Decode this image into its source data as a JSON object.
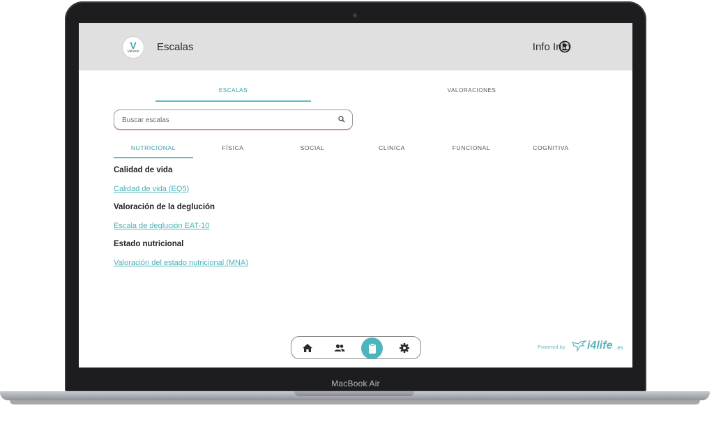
{
  "device": {
    "label": "MacBook Air"
  },
  "header": {
    "logo_text": "Valoreo",
    "title": "Escalas",
    "user_name": "Info Info"
  },
  "main_tabs": [
    {
      "label": "ESCALAS",
      "active": true
    },
    {
      "label": "VALORACIONES",
      "active": false
    }
  ],
  "search": {
    "placeholder": "Buscar escalas",
    "value": ""
  },
  "category_tabs": [
    {
      "label": "NUTRICIONAL",
      "active": true
    },
    {
      "label": "FÍSICA",
      "active": false
    },
    {
      "label": "SOCIAL",
      "active": false
    },
    {
      "label": "CLINICA",
      "active": false
    },
    {
      "label": "FUNCIONAL",
      "active": false
    },
    {
      "label": "COGNITIVA",
      "active": false
    }
  ],
  "sections": [
    {
      "title": "Calidad de vida",
      "links": [
        "Calidad de vida (EQ5)"
      ]
    },
    {
      "title": "Valoración de la deglución",
      "links": [
        "Escala de deglución EAT-10"
      ]
    },
    {
      "title": "Estado nutricional",
      "links": [
        "Valoración del estado nutricional (MNA)"
      ]
    }
  ],
  "bottom_nav": [
    {
      "icon": "home-icon",
      "active": false
    },
    {
      "icon": "users-icon",
      "active": false
    },
    {
      "icon": "clipboard-icon",
      "active": true
    },
    {
      "icon": "gear-icon",
      "active": false
    }
  ],
  "footer": {
    "powered_by": "Powered by",
    "brand": "i4life",
    "brand_tld": ".es"
  },
  "colors": {
    "accent": "#4fb5bc",
    "header_bg": "#e0e0e0",
    "link": "#46b2b9"
  }
}
